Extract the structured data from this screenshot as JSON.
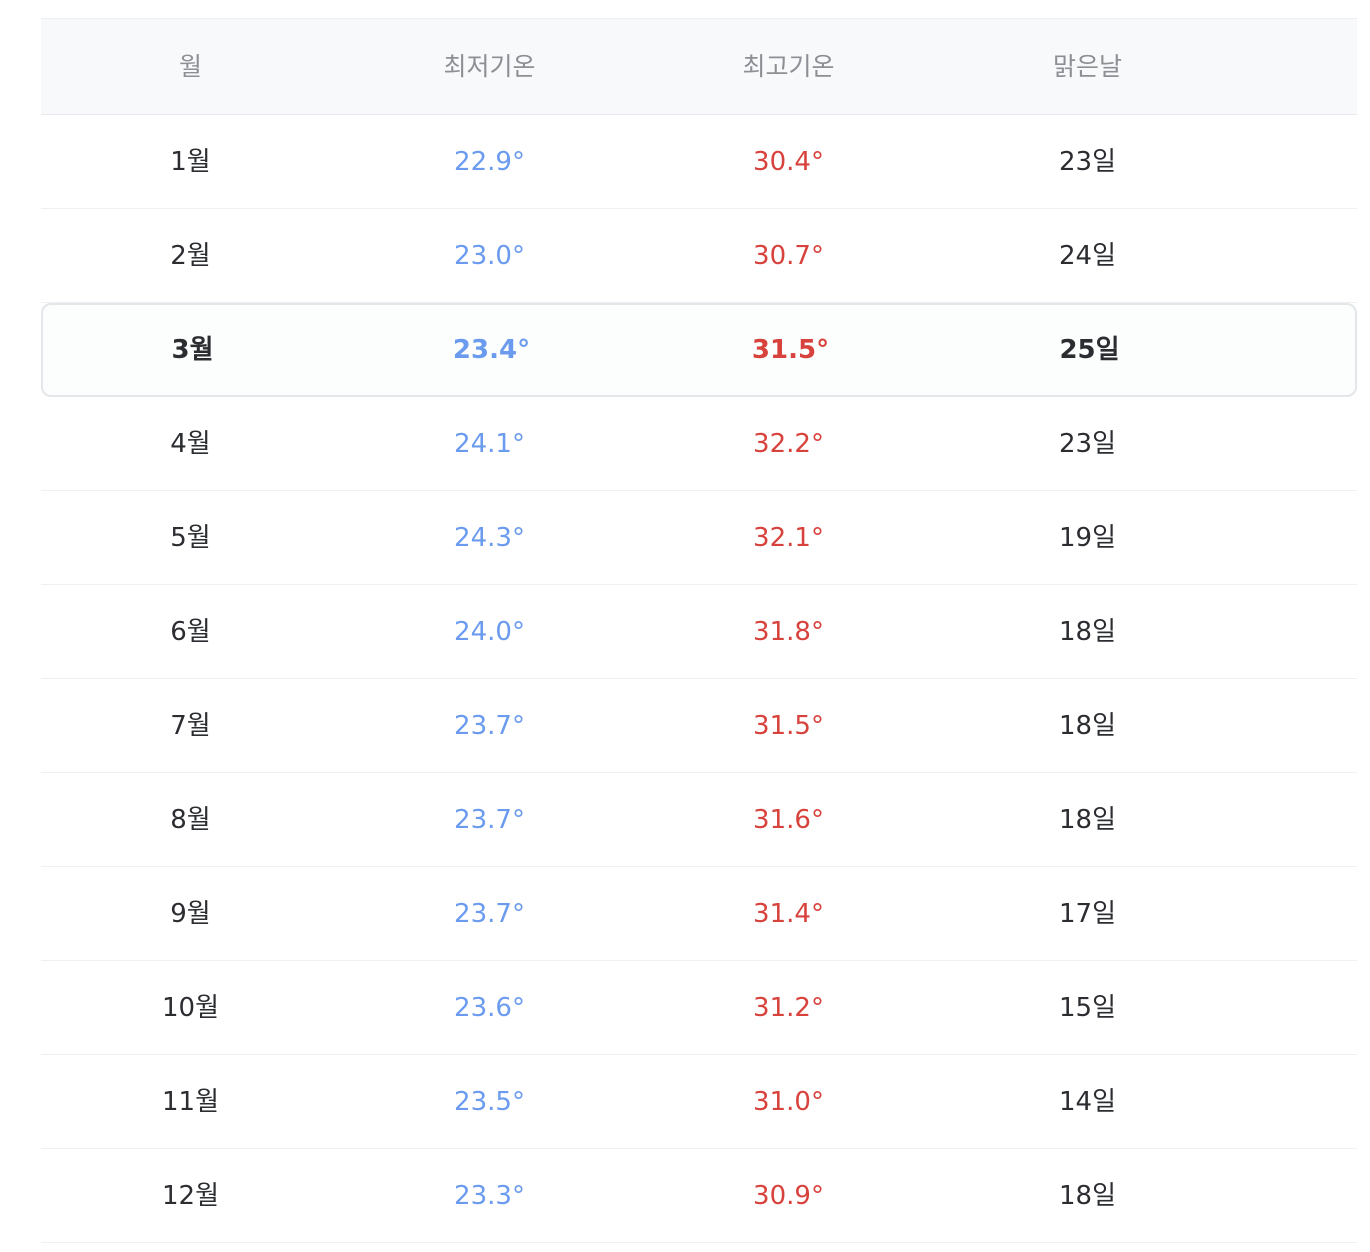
{
  "header": {
    "month": "월",
    "low": "최저기온",
    "high": "최고기온",
    "sunny": "맑은날"
  },
  "rows": [
    {
      "month": "1월",
      "low": "22.9°",
      "high": "30.4°",
      "sunny": "23일"
    },
    {
      "month": "2월",
      "low": "23.0°",
      "high": "30.7°",
      "sunny": "24일"
    },
    {
      "month": "3월",
      "low": "23.4°",
      "high": "31.5°",
      "sunny": "25일"
    },
    {
      "month": "4월",
      "low": "24.1°",
      "high": "32.2°",
      "sunny": "23일"
    },
    {
      "month": "5월",
      "low": "24.3°",
      "high": "32.1°",
      "sunny": "19일"
    },
    {
      "month": "6월",
      "low": "24.0°",
      "high": "31.8°",
      "sunny": "18일"
    },
    {
      "month": "7월",
      "low": "23.7°",
      "high": "31.5°",
      "sunny": "18일"
    },
    {
      "month": "8월",
      "low": "23.7°",
      "high": "31.6°",
      "sunny": "18일"
    },
    {
      "month": "9월",
      "low": "23.7°",
      "high": "31.4°",
      "sunny": "17일"
    },
    {
      "month": "10월",
      "low": "23.6°",
      "high": "31.2°",
      "sunny": "15일"
    },
    {
      "month": "11월",
      "low": "23.5°",
      "high": "31.0°",
      "sunny": "14일"
    },
    {
      "month": "12월",
      "low": "23.3°",
      "high": "30.9°",
      "sunny": "18일"
    }
  ],
  "highlighted_row": 2,
  "colors": {
    "low_temp": "#6b9bef",
    "high_temp": "#d8423c",
    "text": "#2b2d31",
    "header_text": "#8c8f94",
    "header_bg": "#f8f9fa"
  }
}
